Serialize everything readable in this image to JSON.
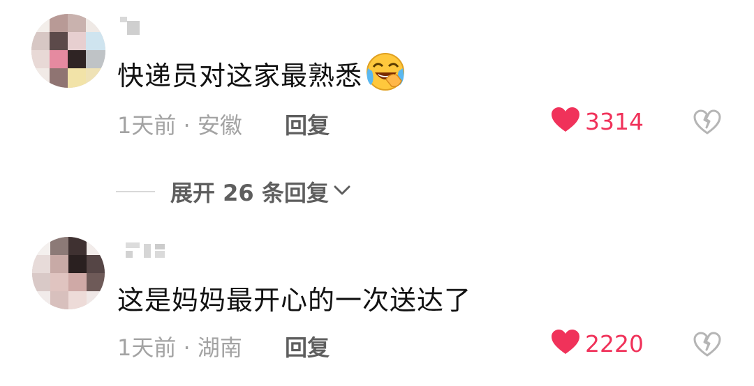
{
  "comments": [
    {
      "text": "快递员对这家最熟悉",
      "time": "1天前",
      "separator": "·",
      "location": "安徽",
      "reply_label": "回复",
      "like_count": "3314",
      "emoji": "face-with-tears-of-joy-hand"
    },
    {
      "text": "这是妈妈最开心的一次送达了",
      "time": "1天前",
      "separator": "·",
      "location": "湖南",
      "reply_label": "回复",
      "like_count": "2220"
    }
  ],
  "expand_replies": {
    "label": "展开 26 条回复"
  },
  "colors": {
    "like": "#f0325a",
    "text": "#111111",
    "meta": "#a3a3a3",
    "reply": "#5e5e5e"
  }
}
